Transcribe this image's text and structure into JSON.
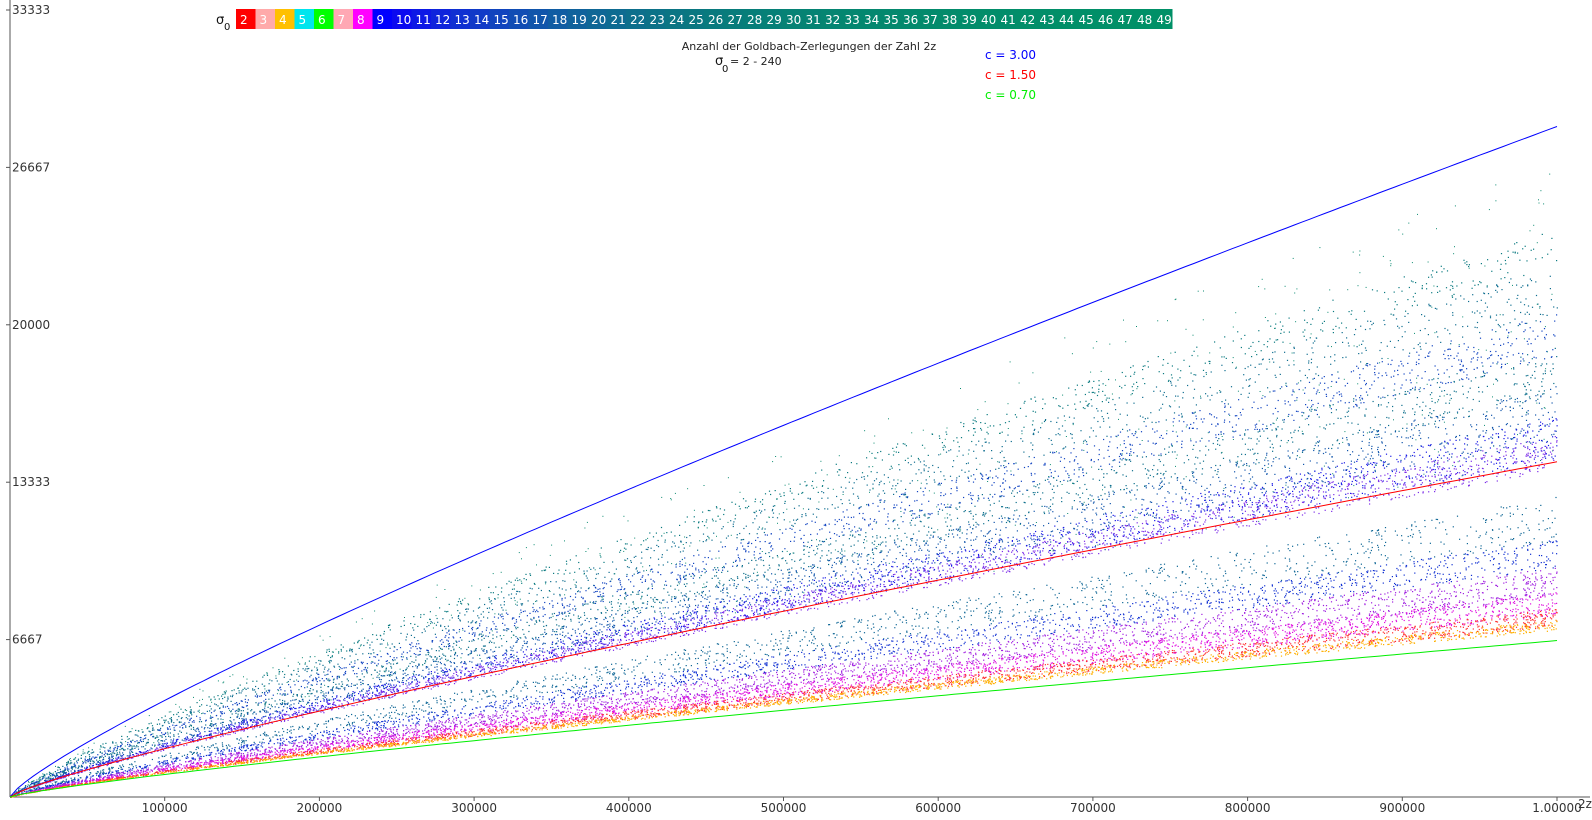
{
  "chart_data": {
    "type": "scatter",
    "title": "Anzahl der Goldbach-Zerlegungen der Zahl 2z",
    "subtitle_symbol": "σ",
    "subtitle_subscript": "0",
    "subtitle_text": "= 2 - 240",
    "xlabel": "2z",
    "xlim": [
      0,
      1000000
    ],
    "ylim": [
      0,
      33333
    ],
    "x_ticks": [
      100000,
      200000,
      300000,
      400000,
      500000,
      600000,
      700000,
      800000,
      900000,
      1000000
    ],
    "x_tick_labels": [
      "100000",
      "200000",
      "300000",
      "400000",
      "500000",
      "600000",
      "700000",
      "800000",
      "900000",
      "1.00000"
    ],
    "y_ticks": [
      6667,
      13333,
      20000,
      26667,
      33333
    ],
    "y_tick_labels": [
      "6667",
      "13333",
      "20000",
      "26667",
      "33333"
    ],
    "sigma_legend": {
      "label": "σ",
      "label_sub": "0",
      "entries": [
        {
          "label": "2",
          "color": "#ff0000"
        },
        {
          "label": "3",
          "color": "#ffaaaa"
        },
        {
          "label": "4",
          "color": "#ffc000"
        },
        {
          "label": "5",
          "color": "#00e5ee"
        },
        {
          "label": "6",
          "color": "#00ff00"
        },
        {
          "label": "7",
          "color": "#ffa8b4"
        },
        {
          "label": "8",
          "color": "#ff00ff"
        },
        {
          "label": "9",
          "color": "#0000ff"
        },
        {
          "label": "10",
          "color": "#0b0af0"
        },
        {
          "label": "11",
          "color": "#0d18e6"
        },
        {
          "label": "12",
          "color": "#0f24dc"
        },
        {
          "label": "13",
          "color": "#1030d2"
        },
        {
          "label": "14",
          "color": "#113ac8"
        },
        {
          "label": "15",
          "color": "#1144be"
        },
        {
          "label": "16",
          "color": "#114db4"
        },
        {
          "label": "17",
          "color": "#1155ab"
        },
        {
          "label": "18",
          "color": "#105ca3"
        },
        {
          "label": "19",
          "color": "#10629c"
        },
        {
          "label": "20",
          "color": "#0f6796"
        },
        {
          "label": "21",
          "color": "#0e6b91"
        },
        {
          "label": "22",
          "color": "#0d6f8c"
        },
        {
          "label": "23",
          "color": "#0c7288"
        },
        {
          "label": "24",
          "color": "#0b7584"
        },
        {
          "label": "25",
          "color": "#0a7781"
        },
        {
          "label": "26",
          "color": "#097a7e"
        },
        {
          "label": "27",
          "color": "#087c7b"
        },
        {
          "label": "28",
          "color": "#077e79"
        },
        {
          "label": "29",
          "color": "#068077"
        },
        {
          "label": "30",
          "color": "#068275"
        },
        {
          "label": "31",
          "color": "#058373"
        },
        {
          "label": "32",
          "color": "#058572"
        },
        {
          "label": "33",
          "color": "#048670"
        },
        {
          "label": "34",
          "color": "#04876f"
        },
        {
          "label": "35",
          "color": "#04886e"
        },
        {
          "label": "36",
          "color": "#03896d"
        },
        {
          "label": "37",
          "color": "#038a6c"
        },
        {
          "label": "38",
          "color": "#038b6b"
        },
        {
          "label": "39",
          "color": "#028c6b"
        },
        {
          "label": "40",
          "color": "#028d6a"
        },
        {
          "label": "41",
          "color": "#028d6a"
        },
        {
          "label": "42",
          "color": "#028e69"
        },
        {
          "label": "43",
          "color": "#018e69"
        },
        {
          "label": "44",
          "color": "#018f68"
        },
        {
          "label": "45",
          "color": "#018f68"
        },
        {
          "label": "46",
          "color": "#018f68"
        },
        {
          "label": "47",
          "color": "#019067"
        },
        {
          "label": "48",
          "color": "#009067"
        },
        {
          "label": "49",
          "color": "#009067"
        }
      ]
    },
    "bound_curves": [
      {
        "name": "c = 3.00",
        "c": 3.0,
        "color": "#0000ff"
      },
      {
        "name": "c = 1.50",
        "c": 1.5,
        "color": "#ff0000"
      },
      {
        "name": "c = 0.70",
        "c": 0.7,
        "color": "#00ee00"
      }
    ],
    "grid": false,
    "point_cloud": {
      "description_free": true,
      "bands": [
        {
          "slope_at_max": 23300,
          "spread": 0.035,
          "density": 0.5,
          "color": "#0a7a80"
        },
        {
          "slope_at_max": 21500,
          "spread": 0.05,
          "density": 0.7,
          "color": "#0e6d8f"
        },
        {
          "slope_at_max": 19600,
          "spread": 0.05,
          "density": 1.0,
          "color": "#1043c0"
        },
        {
          "slope_at_max": 18000,
          "spread": 0.06,
          "density": 1.0,
          "color": "#0d6f8c"
        },
        {
          "slope_at_max": 16300,
          "spread": 0.07,
          "density": 1.2,
          "color": "#1155ab"
        },
        {
          "slope_at_max": 15200,
          "spread": 0.06,
          "density": 1.4,
          "color": "#1a1ae6"
        },
        {
          "slope_at_max": 14600,
          "spread": 0.05,
          "density": 1.4,
          "color": "#7d2de8"
        },
        {
          "slope_at_max": 11800,
          "spread": 0.08,
          "density": 0.9,
          "color": "#0f6796"
        },
        {
          "slope_at_max": 10300,
          "spread": 0.06,
          "density": 1.2,
          "color": "#1030d2"
        },
        {
          "slope_at_max": 9100,
          "spread": 0.07,
          "density": 1.6,
          "color": "#a020e0"
        },
        {
          "slope_at_max": 8200,
          "spread": 0.06,
          "density": 1.8,
          "color": "#e010e0"
        },
        {
          "slope_at_max": 7600,
          "spread": 0.05,
          "density": 1.6,
          "color": "#ff3030"
        },
        {
          "slope_at_max": 7300,
          "spread": 0.03,
          "density": 1.2,
          "color": "#ffb000"
        }
      ],
      "outliers_color": "#0a8a70"
    }
  }
}
